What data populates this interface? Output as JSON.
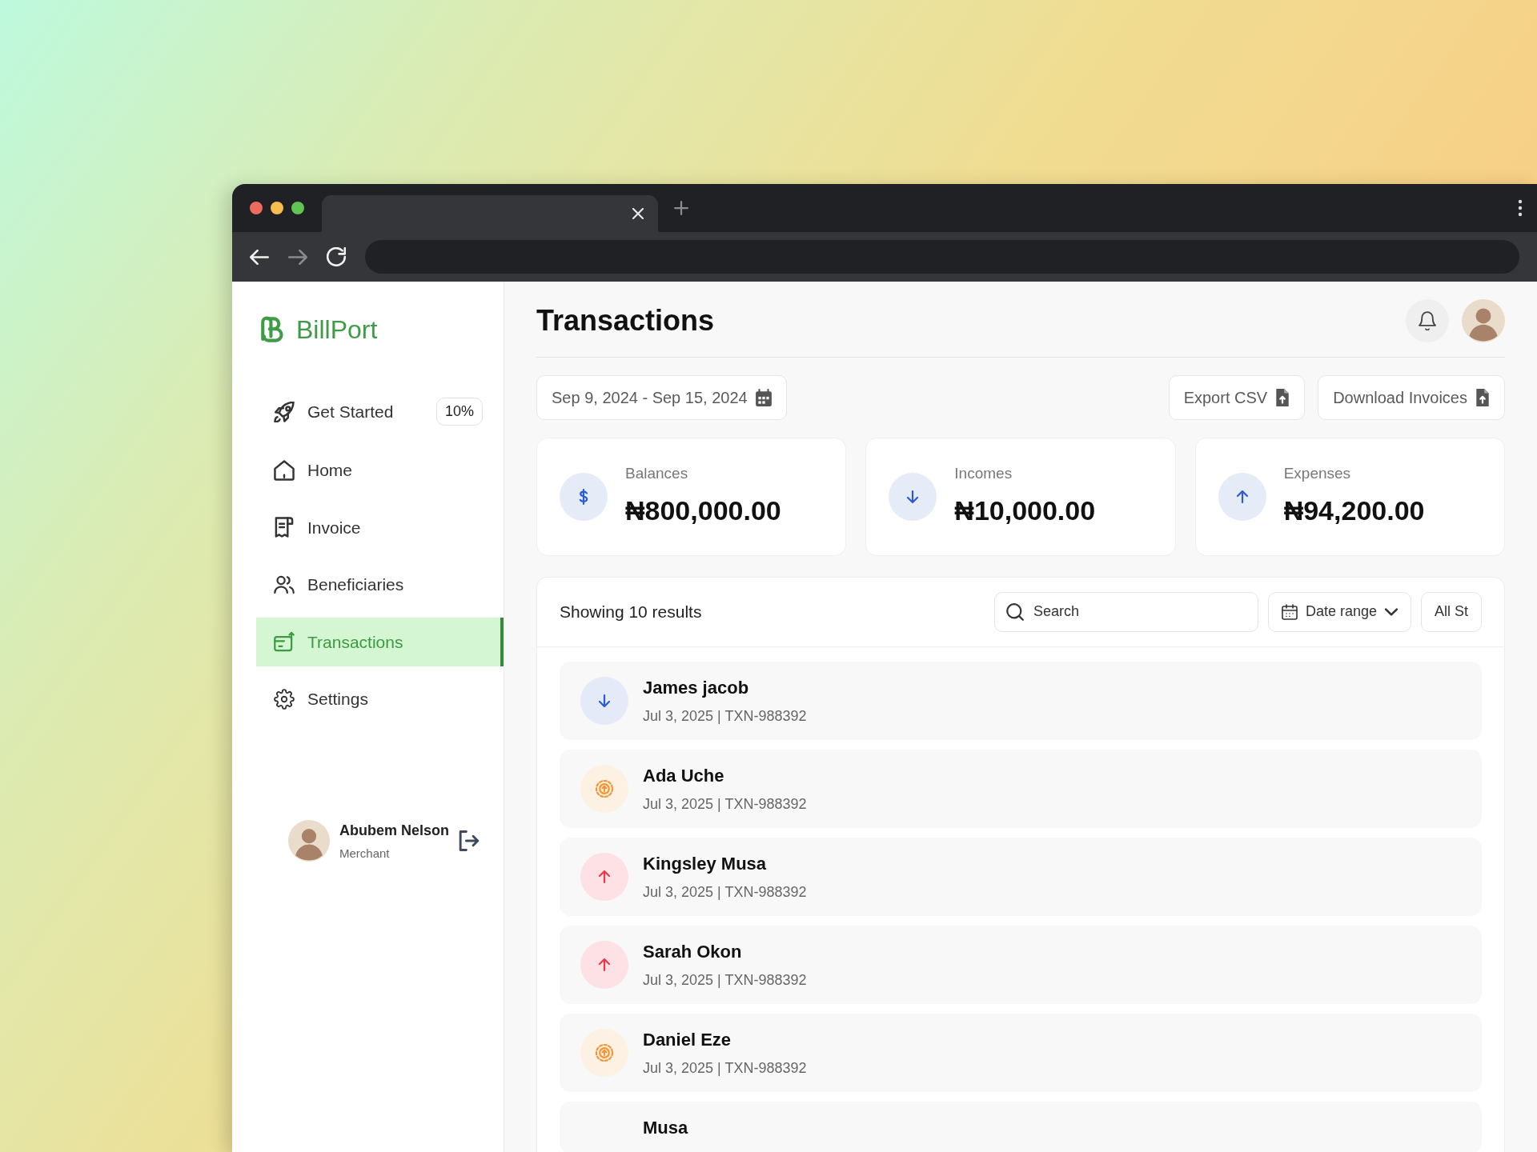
{
  "sidebar": {
    "logo": "BillPort",
    "items": [
      {
        "label": "Get Started",
        "badge": "10%",
        "selected": false
      },
      {
        "label": "Home",
        "selected": false
      },
      {
        "label": "Invoice",
        "selected": false
      },
      {
        "label": "Beneficiaries",
        "selected": false
      },
      {
        "label": "Transactions",
        "selected": true
      },
      {
        "label": "Settings",
        "selected": false
      }
    ],
    "user": {
      "name": "Abubem Nelson",
      "role": "Merchant"
    }
  },
  "header": {
    "title": "Transactions"
  },
  "actions": {
    "date_range": "Sep 9, 2024 - Sep 15, 2024",
    "buttons": [
      "Export CSV",
      "Download Invoices"
    ]
  },
  "stats": [
    {
      "label": "Balances",
      "value": "₦800,000.00",
      "kind": "balance"
    },
    {
      "label": "Incomes",
      "value": "₦10,000.00",
      "kind": "income"
    },
    {
      "label": "Expenses",
      "value": "₦94,200.00",
      "kind": "expense"
    }
  ],
  "results": {
    "summary": "Showing 10 results",
    "search": {
      "placeholder": "Search"
    },
    "filters": [
      {
        "label": "Date range",
        "kind": "date"
      },
      {
        "label": "All St",
        "kind": "plain"
      }
    ],
    "rows": [
      {
        "name": "James jacob",
        "meta": "Jul 3, 2025 | TXN-988392",
        "kind": "incoming"
      },
      {
        "name": "Ada Uche",
        "meta": "Jul 3, 2025 | TXN-988392",
        "kind": "pending"
      },
      {
        "name": "Kingsley Musa",
        "meta": "Jul 3, 2025 | TXN-988392",
        "kind": "outgoing"
      },
      {
        "name": "Sarah Okon",
        "meta": "Jul 3, 2025 | TXN-988392",
        "kind": "outgoing"
      },
      {
        "name": "Daniel Eze",
        "meta": "Jul 3, 2025 | TXN-988392",
        "kind": "pending"
      },
      {
        "name": "Musa"
      }
    ]
  }
}
